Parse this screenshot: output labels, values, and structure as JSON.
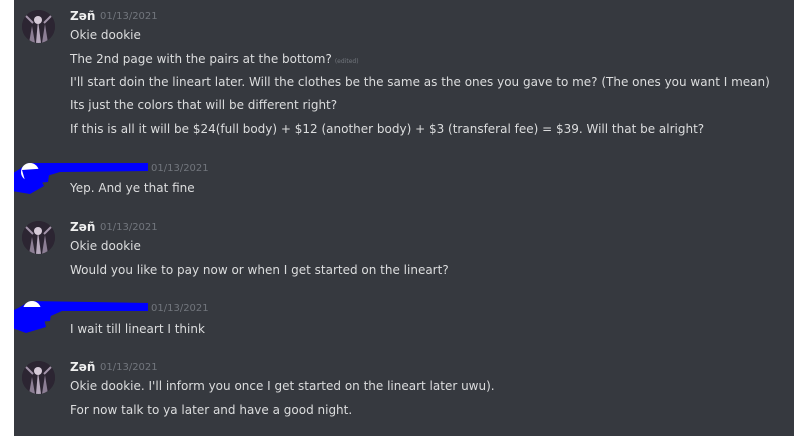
{
  "messages": [
    {
      "author": "Zəñ",
      "timestamp": "01/13/2021",
      "avatar": "character-art-avatar",
      "lines": [
        {
          "text": "Okie dookie"
        },
        {
          "text": "The 2nd page with the pairs at the bottom?",
          "edited": "(edited)"
        },
        {
          "text": "I'll start doin the lineart later. Will the clothes be the same as the ones you gave to me? (The ones you want I mean)"
        },
        {
          "text": "Its just the colors that will be different right?"
        },
        {
          "text": "If this is all it will be $24(full body) + $12 (another body) + $3 (transferal fee) = $39. Will that be alright?"
        }
      ]
    },
    {
      "author": "",
      "author_redacted": true,
      "timestamp": "01/13/2021",
      "lines": [
        {
          "text": "Yep. And ye that fine"
        }
      ]
    },
    {
      "author": "Zəñ",
      "timestamp": "01/13/2021",
      "avatar": "character-art-avatar",
      "lines": [
        {
          "text": "Okie dookie"
        },
        {
          "text": "Would you like to pay now or when I get started on the lineart?"
        }
      ]
    },
    {
      "author": "",
      "author_redacted": true,
      "timestamp": "01/13/2021",
      "lines": [
        {
          "text": "I wait till lineart I think"
        }
      ]
    },
    {
      "author": "Zəñ",
      "timestamp": "01/13/2021",
      "avatar": "character-art-avatar",
      "lines": [
        {
          "text": "Okie dookie. I'll inform you once I get started on the lineart later uwu)."
        },
        {
          "text": "For now talk to ya later and have a good night."
        }
      ]
    }
  ],
  "colors": {
    "background": "#36393f",
    "text": "#dcddde",
    "username": "#f0f0f0",
    "timestamp": "#72767d",
    "redaction": "#0000ff"
  }
}
